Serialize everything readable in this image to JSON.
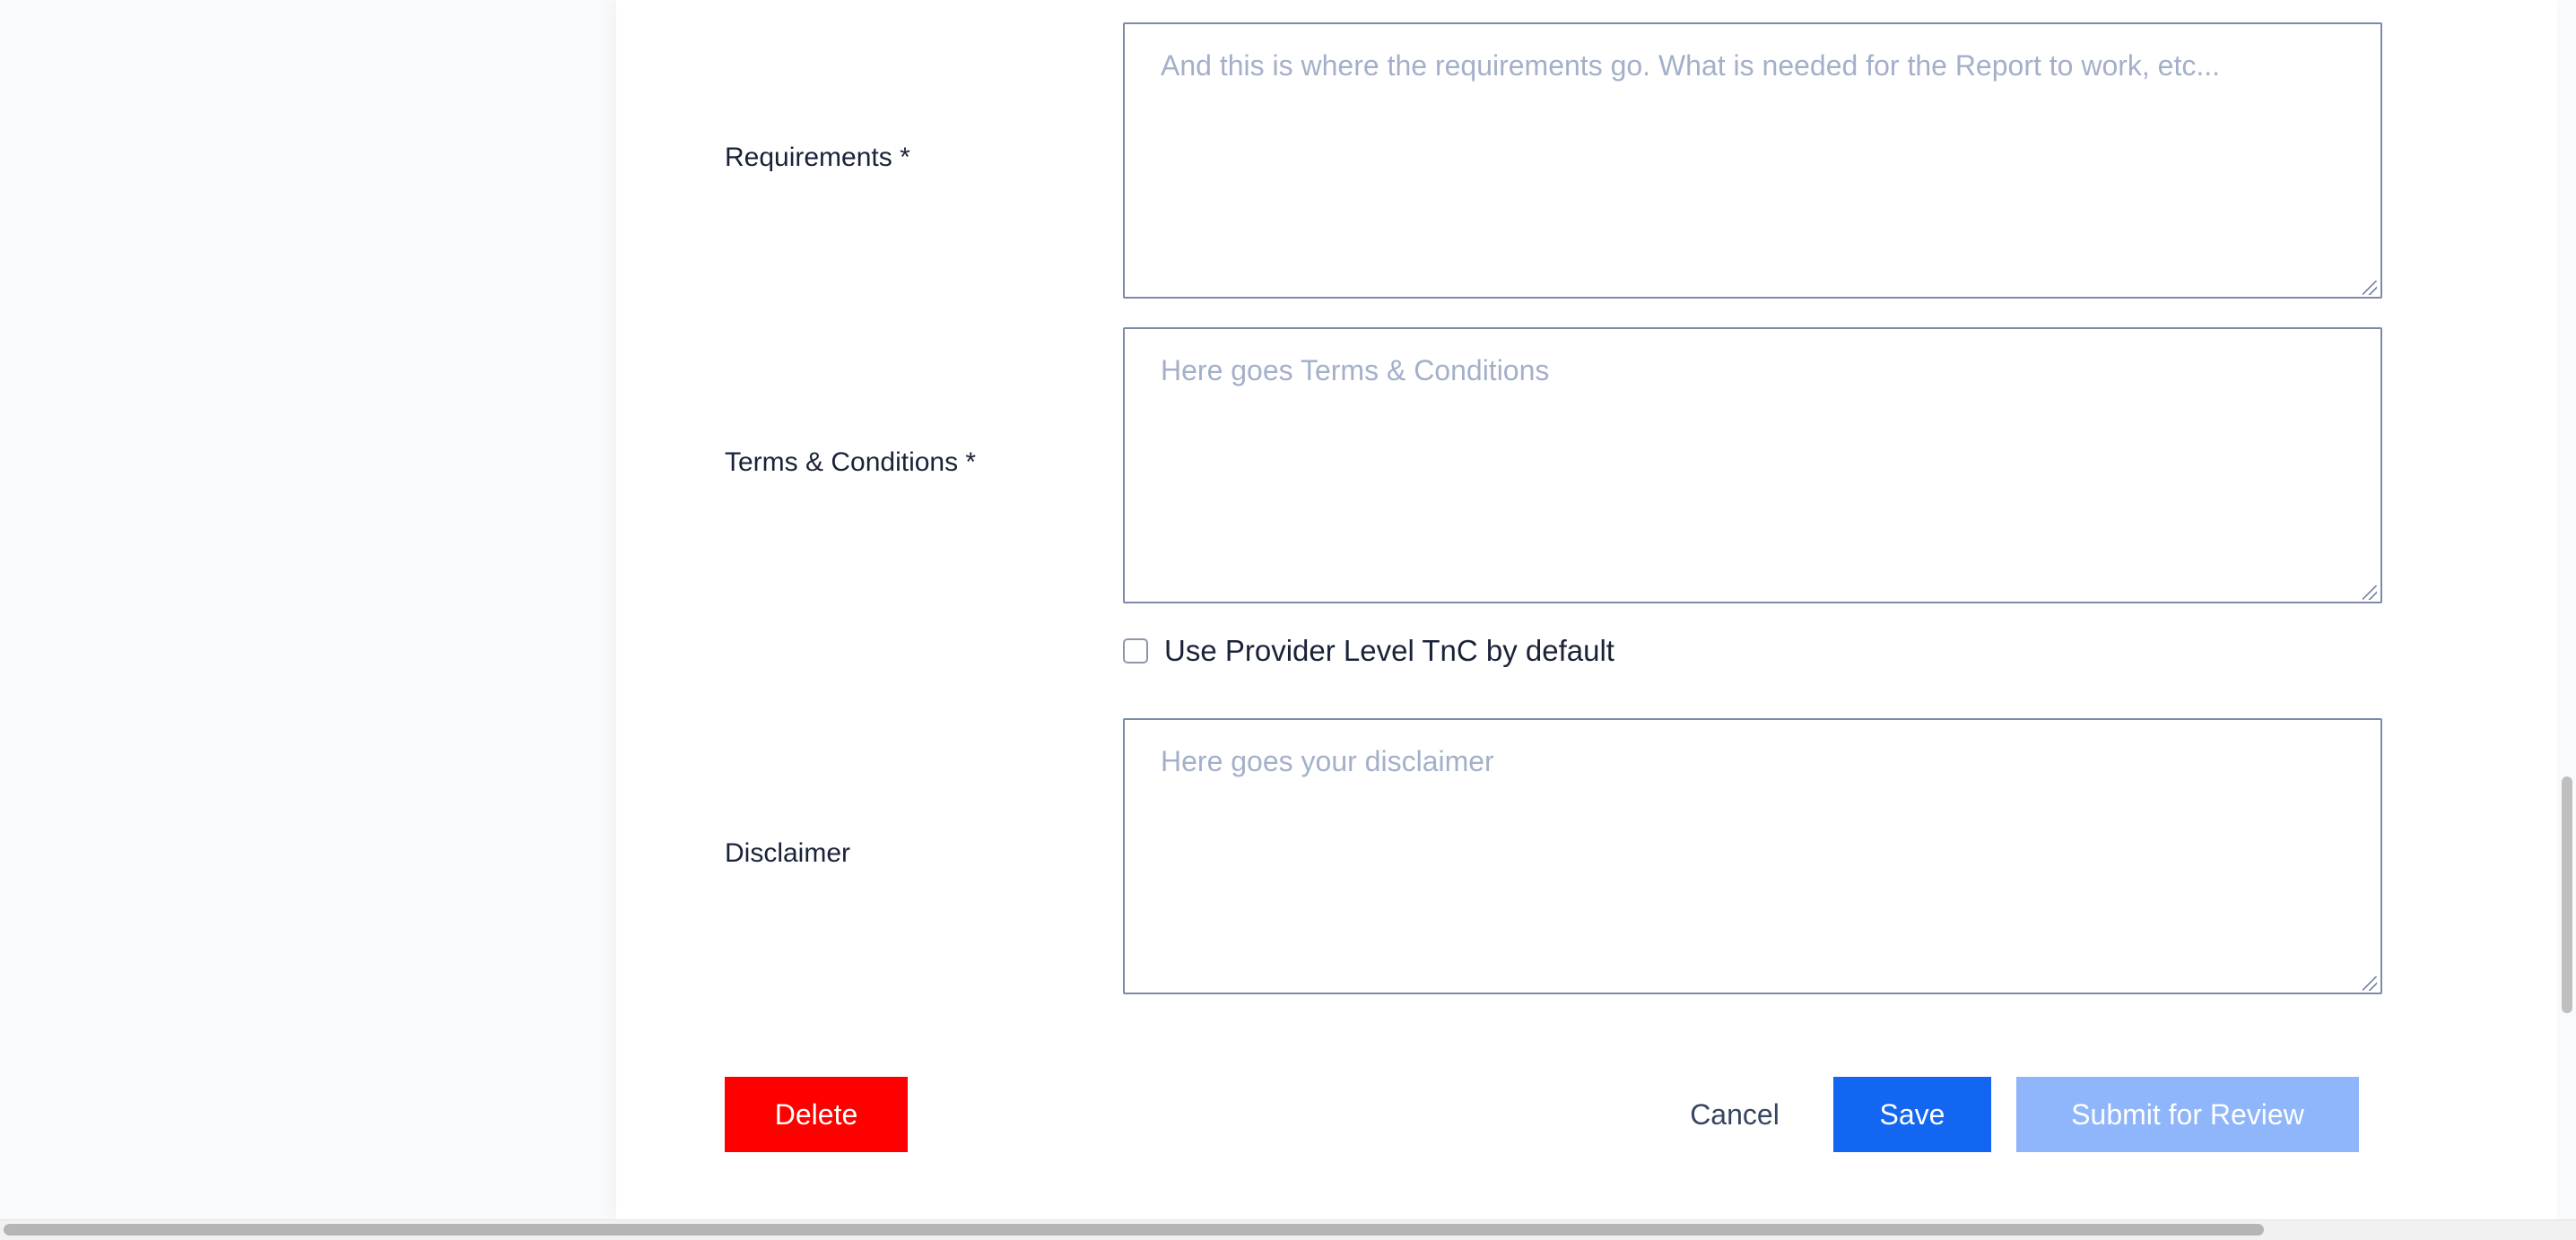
{
  "form": {
    "requirements": {
      "label": "Requirements *",
      "placeholder": "And this is where the requirements go. What is needed for the Report to work, etc..."
    },
    "terms": {
      "label": "Terms & Conditions *",
      "placeholder": "Here goes Terms & Conditions"
    },
    "use_provider_tnc": {
      "label": "Use Provider Level TnC by default",
      "checked": false
    },
    "disclaimer": {
      "label": "Disclaimer",
      "placeholder": "Here goes your disclaimer"
    }
  },
  "actions": {
    "delete_label": "Delete",
    "cancel_label": "Cancel",
    "save_label": "Save",
    "submit_label": "Submit for Review"
  },
  "colors": {
    "delete": "#ff0000",
    "save": "#1266f1",
    "submit_disabled": "#8fb5fa"
  }
}
